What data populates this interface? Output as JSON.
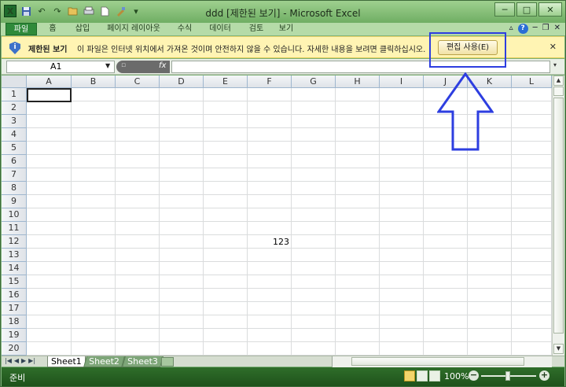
{
  "window": {
    "title": "ddd  [제한된 보기] - Microsoft Excel",
    "app_icon": "X",
    "controls": [
      "minimize-icon",
      "maximize-icon",
      "close-icon"
    ],
    "minimize_glyph": "─",
    "maximize_glyph": "□",
    "close_glyph": "✕"
  },
  "qat": {
    "icons": [
      "save-icon",
      "undo-icon",
      "redo-icon",
      "open-icon",
      "print-icon",
      "new-icon",
      "format-icon",
      "customize-icon"
    ]
  },
  "ribbon": {
    "tabs": [
      "파일",
      "홈",
      "삽입",
      "페이지 레이아웃",
      "수식",
      "데이터",
      "검토",
      "보기"
    ],
    "help_glyph": "?"
  },
  "protected_view": {
    "title": "제한된 보기",
    "message": "이 파일은 인터넷 위치에서 가져온 것이며 안전하지 않을 수 있습니다. 자세한 내용을 보려면 클릭하십시오.",
    "button_label": "편집 사용(E)",
    "close_glyph": "✕",
    "icon_glyph": "i"
  },
  "formula_bar": {
    "name_box": "A1",
    "fx_label": "fx",
    "formula": ""
  },
  "sheet": {
    "columns": [
      "A",
      "B",
      "C",
      "D",
      "E",
      "F",
      "G",
      "H",
      "I",
      "J",
      "K",
      "L"
    ],
    "rows": [
      "1",
      "2",
      "3",
      "4",
      "5",
      "6",
      "7",
      "8",
      "9",
      "10",
      "11",
      "12",
      "13",
      "14",
      "15",
      "16",
      "17",
      "18",
      "19",
      "20"
    ],
    "cells": [
      {
        "ref": "F12",
        "value": "123"
      }
    ],
    "tabs": [
      "Sheet1",
      "Sheet2",
      "Sheet3"
    ],
    "active_tab": "Sheet1"
  },
  "status": {
    "mode": "준비",
    "zoom": "100%"
  },
  "colors": {
    "accent": "#2f8a3a",
    "annotation": "#2d3ee0",
    "message_bar": "#fff4b3"
  }
}
